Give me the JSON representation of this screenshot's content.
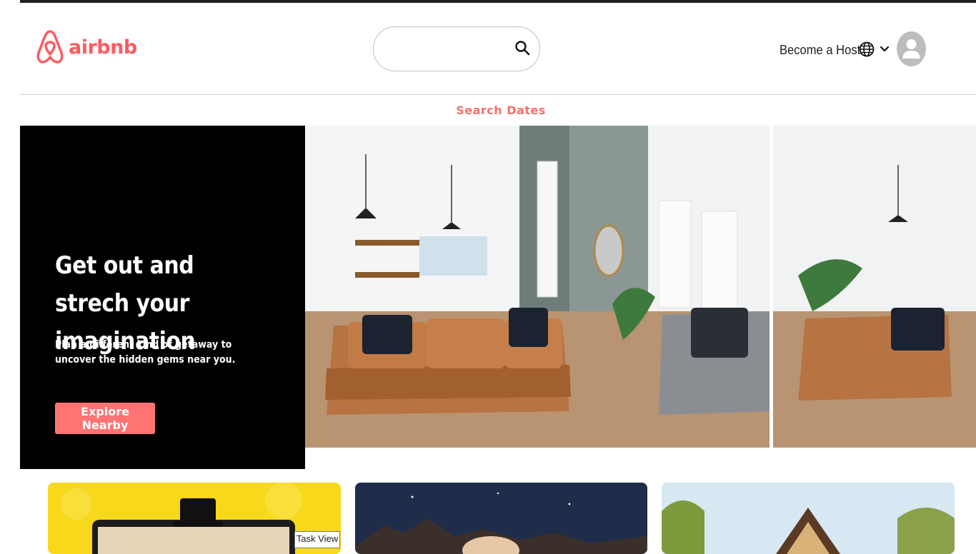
{
  "header": {
    "logo_text": "airbnb",
    "search": {
      "placeholder": "",
      "value": ""
    },
    "become_host": "Become a Host"
  },
  "search_dates": {
    "label": "Search Dates"
  },
  "hero": {
    "title": "Get out and strech your imagination",
    "subtitle": "Plan a different kind of getaway to uncover the hidden gems near you.",
    "button": "Explore Nearby"
  },
  "tooltip": {
    "label": "Task View"
  },
  "colors": {
    "brand": "#ff5a5f",
    "accent": "#ff7373",
    "dates_text": "#f0726c"
  }
}
